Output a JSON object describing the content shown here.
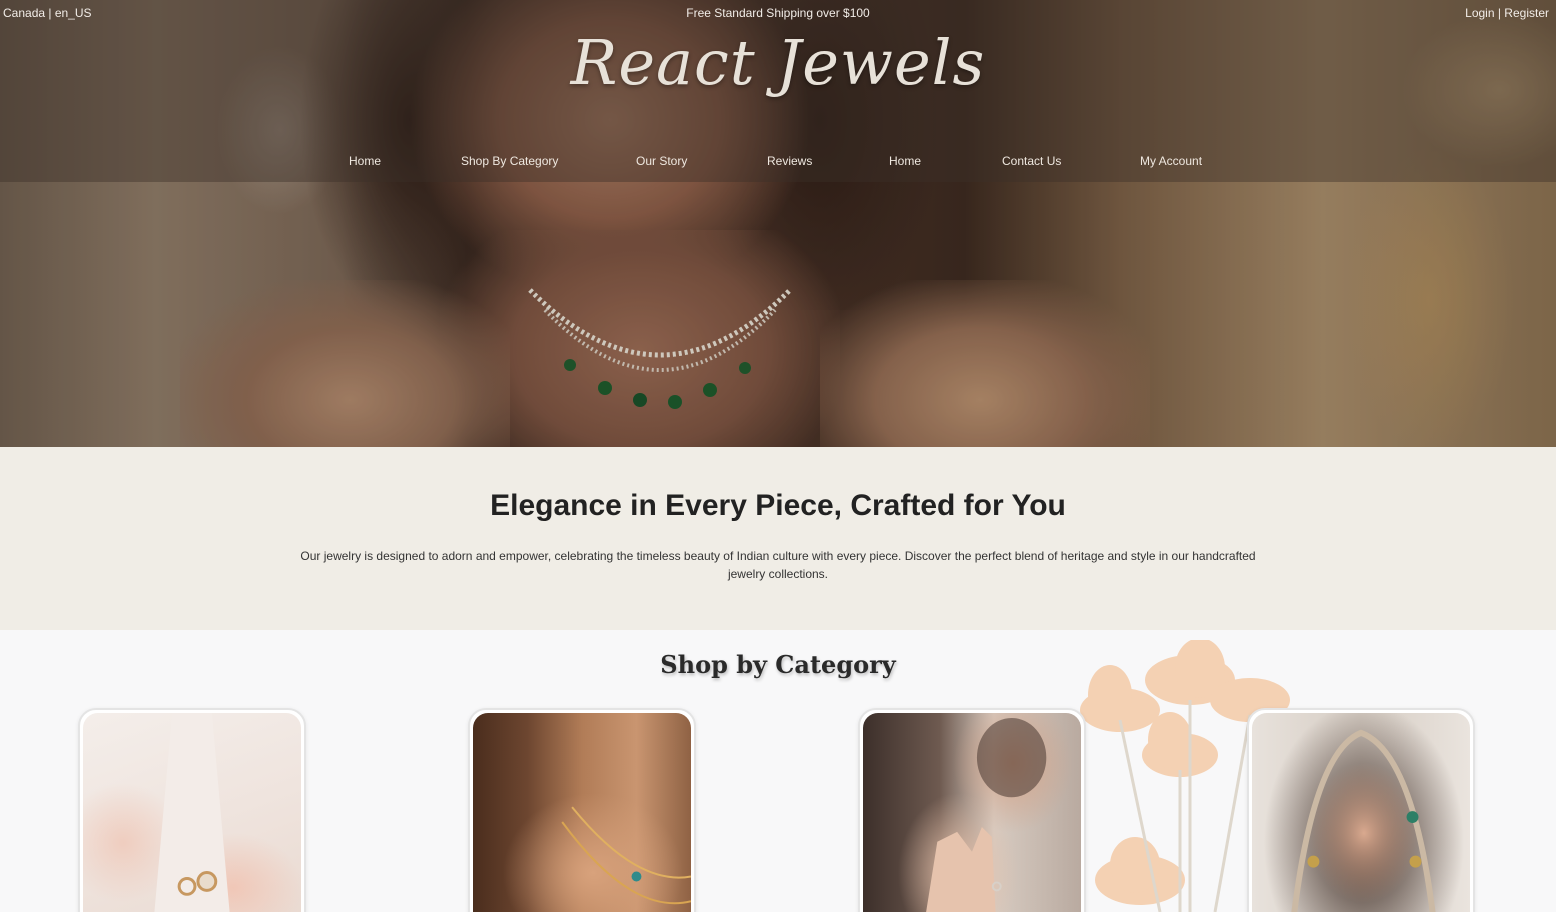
{
  "topbar": {
    "locale": "Canada | en_US",
    "shipping": "Free Standard Shipping over $100",
    "auth": "Login | Register"
  },
  "brand": {
    "logo": "React Jewels"
  },
  "nav": {
    "items": [
      {
        "label": "Home"
      },
      {
        "label": "Shop By Category"
      },
      {
        "label": "Our Story"
      },
      {
        "label": "Reviews"
      },
      {
        "label": "Home"
      },
      {
        "label": "Contact Us"
      },
      {
        "label": "My Account"
      }
    ]
  },
  "intro": {
    "title": "Elegance in Every Piece, Crafted for You",
    "text": "Our jewelry is designed to adorn and empower, celebrating the timeless beauty of Indian culture with every piece. Discover the perfect blend of heritage and style in our handcrafted jewelry collections."
  },
  "categories": {
    "title": "Shop by Category"
  },
  "colors": {
    "intro_background": "#f0ede6",
    "page_background": "#f8f8f9",
    "nav_text": "#efe8e0"
  }
}
